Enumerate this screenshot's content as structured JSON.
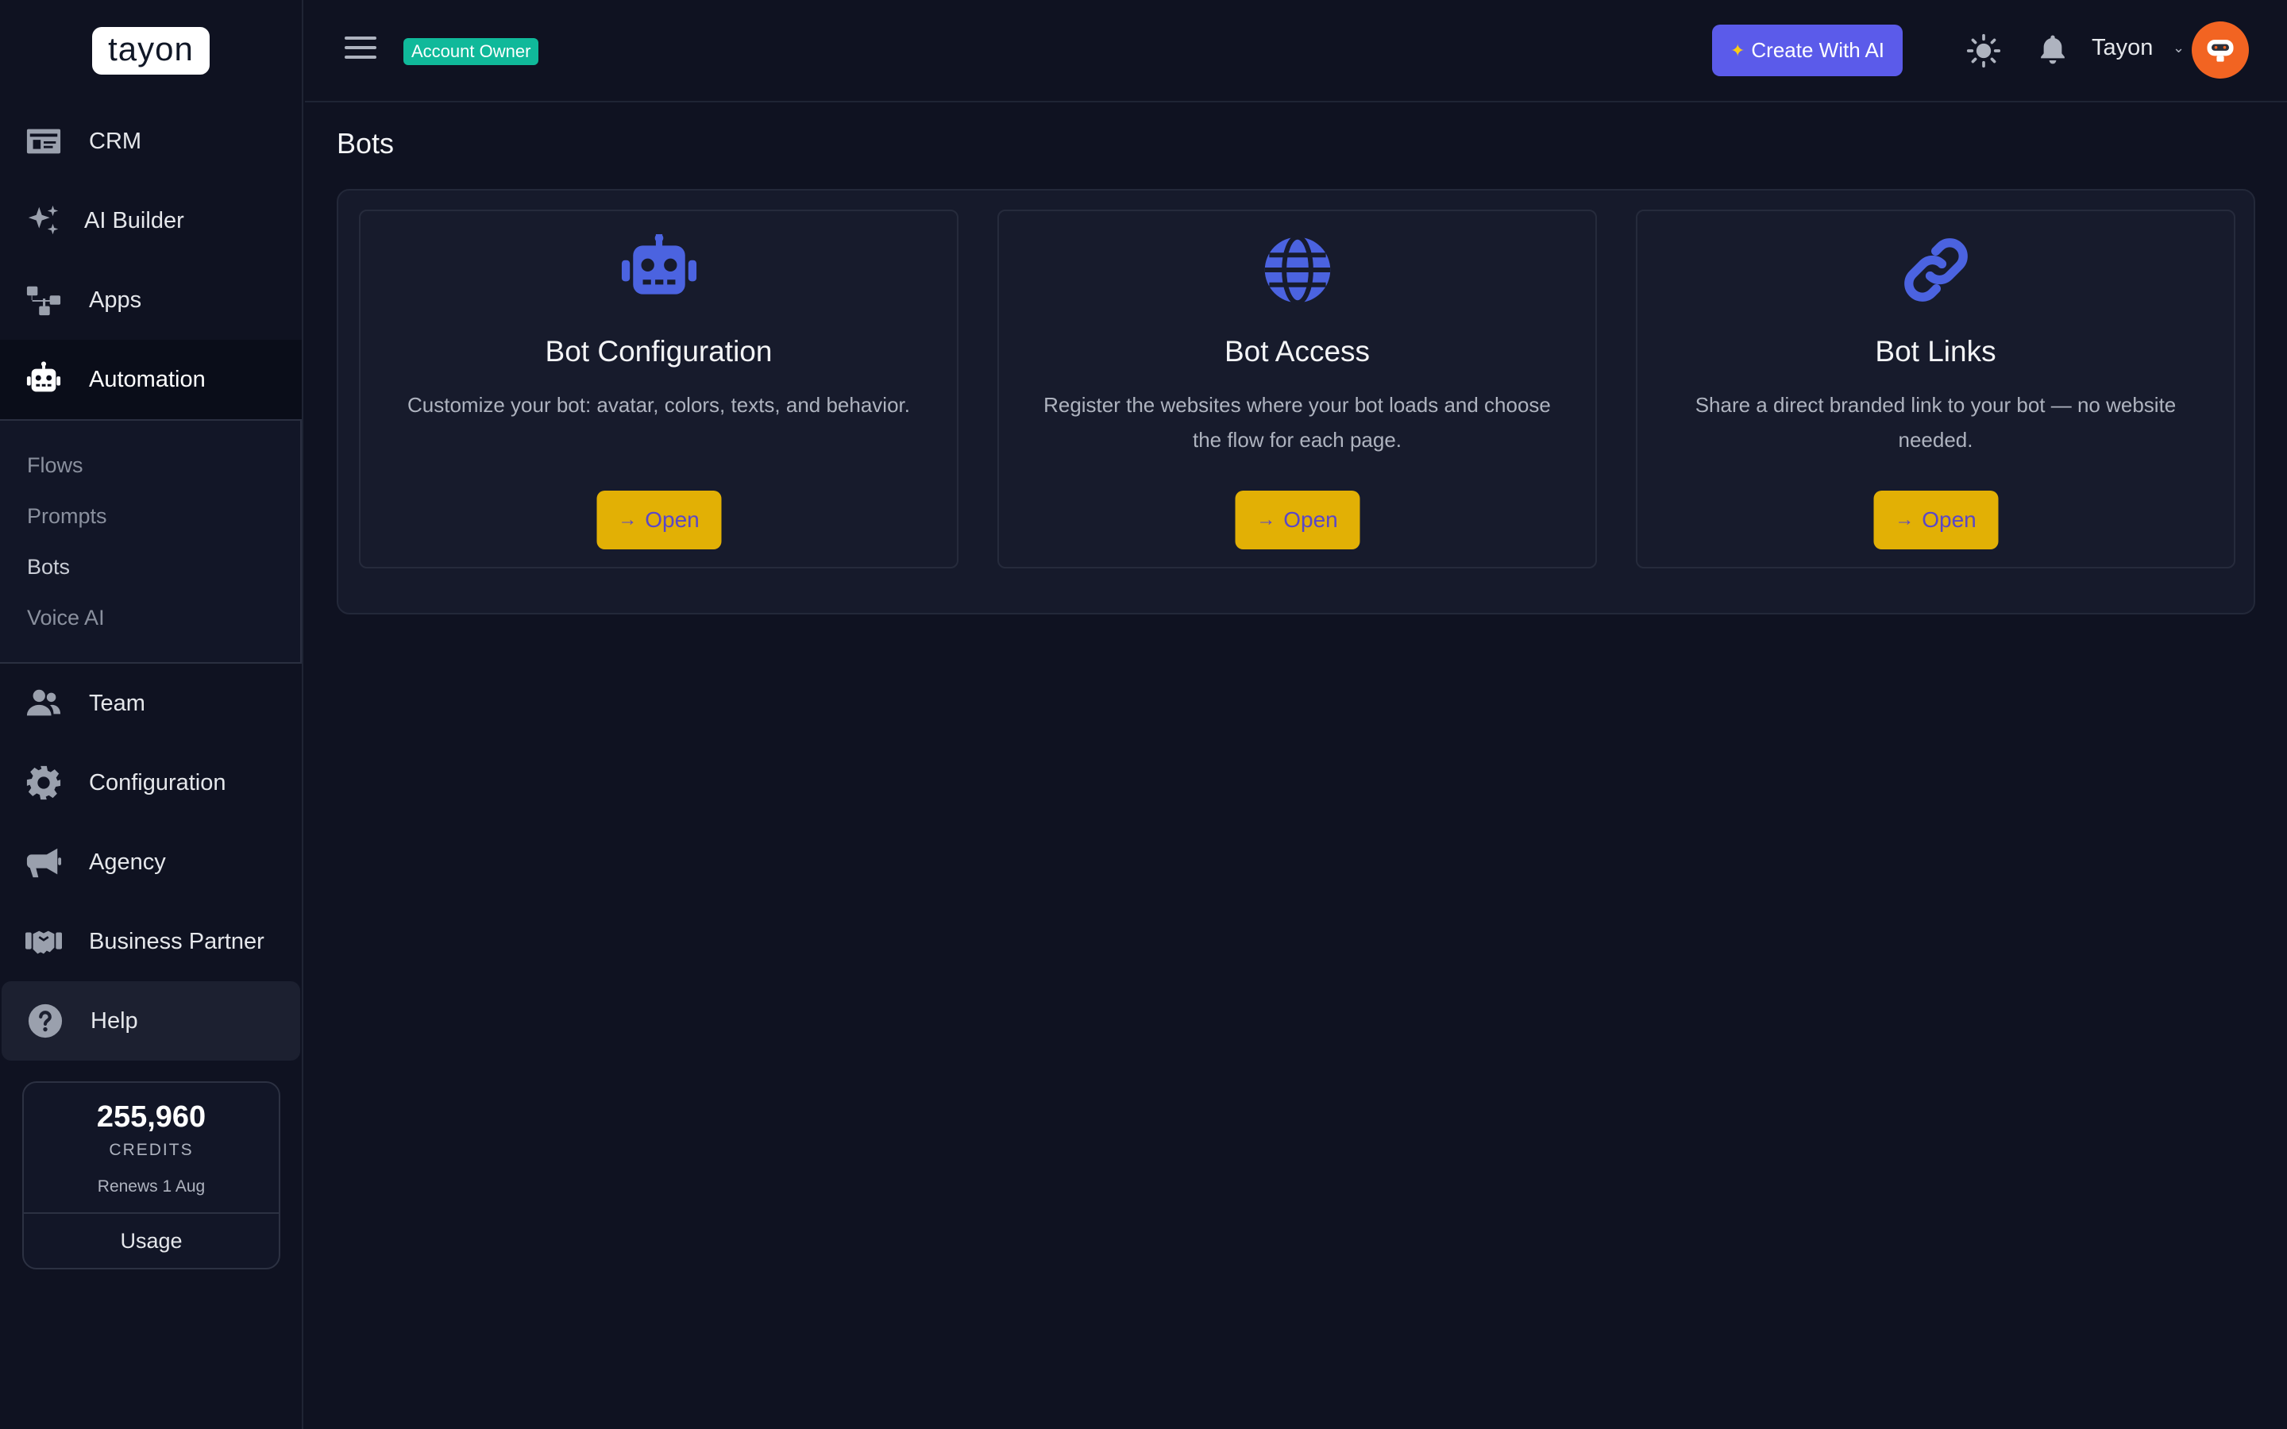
{
  "brand": {
    "logo_text": "tayon"
  },
  "sidebar": {
    "items": [
      {
        "label": "CRM",
        "icon": "id-card-icon"
      },
      {
        "label": "AI Builder",
        "icon": "sparkles-icon"
      },
      {
        "label": "Apps",
        "icon": "sitemap-icon"
      },
      {
        "label": "Automation",
        "icon": "robot-icon"
      },
      {
        "label": "Team",
        "icon": "users-icon"
      },
      {
        "label": "Configuration",
        "icon": "gear-icon"
      },
      {
        "label": "Agency",
        "icon": "megaphone-icon"
      },
      {
        "label": "Business Partner",
        "icon": "handshake-icon"
      },
      {
        "label": "Help",
        "icon": "question-circle-icon"
      }
    ],
    "subitems": [
      "Flows",
      "Prompts",
      "Bots",
      "Voice AI"
    ],
    "active_item": "Automation",
    "active_subitem": "Bots"
  },
  "credits": {
    "amount": "255,960",
    "label": "CREDITS",
    "renews": "Renews 1 Aug",
    "usage_label": "Usage"
  },
  "topbar": {
    "role_badge": "Account Owner",
    "create_label": "Create With AI",
    "user_name": "Tayon"
  },
  "page": {
    "title": "Bots",
    "cards": [
      {
        "title": "Bot Configuration",
        "description": "Customize your bot: avatar, colors, texts, and behavior.",
        "button": "Open",
        "icon": "robot-icon"
      },
      {
        "title": "Bot Access",
        "description": "Register the websites where your bot loads and choose the flow for each page.",
        "button": "Open",
        "icon": "globe-icon"
      },
      {
        "title": "Bot Links",
        "description": "Share a direct branded link to your bot — no website needed.",
        "button": "Open",
        "icon": "link-icon"
      }
    ]
  },
  "colors": {
    "background": "#0f1221",
    "accent_button": "#5b5bea",
    "open_button": "#e2b005",
    "badge": "#10b99a",
    "icon_blue": "#4b63e0",
    "avatar": "#f26422"
  }
}
